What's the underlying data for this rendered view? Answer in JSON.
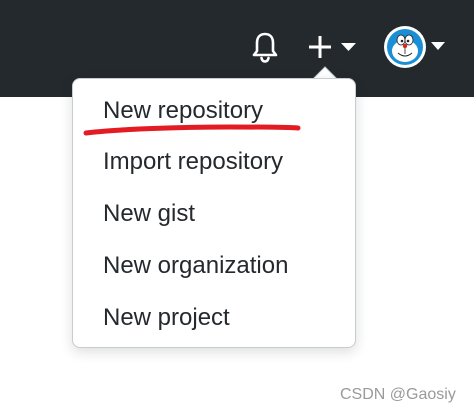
{
  "header": {
    "notifications_icon": "bell-icon",
    "create_icon": "plus-icon",
    "create_caret_icon": "caret-down-icon",
    "avatar_icon": "doraemon-avatar",
    "avatar_caret_icon": "caret-down-icon"
  },
  "dropdown": {
    "items": [
      {
        "label": "New repository"
      },
      {
        "label": "Import repository"
      },
      {
        "label": "New gist"
      },
      {
        "label": "New organization"
      },
      {
        "label": "New project"
      }
    ]
  },
  "annotation": {
    "underline_color": "#e31b23"
  },
  "watermark": {
    "text": "CSDN @Gaosiy"
  },
  "colors": {
    "header_bg": "#24292e",
    "icon_white": "#ffffff",
    "menu_text": "#24292e",
    "menu_border": "#c8ccd1"
  }
}
